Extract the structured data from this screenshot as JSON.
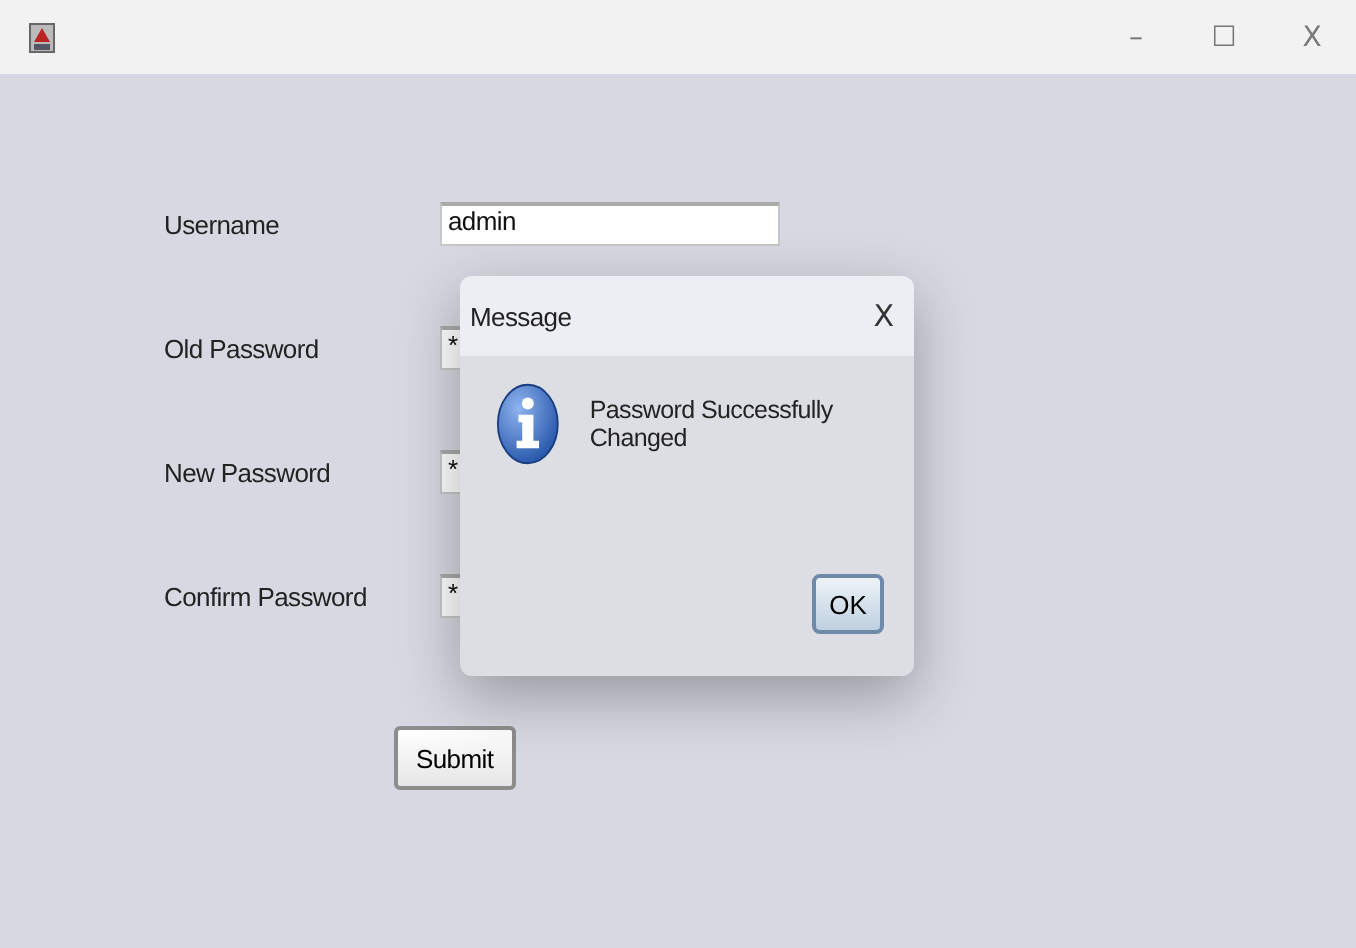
{
  "window": {
    "controls": [
      "–",
      "☐",
      "X"
    ]
  },
  "form": {
    "fields": [
      {
        "label": "Username",
        "value": "admin"
      },
      {
        "label": "Old Password",
        "value": "*"
      },
      {
        "label": "New Password",
        "value": "*"
      },
      {
        "label": "Confirm Password",
        "value": "*"
      }
    ],
    "submit": "Submit"
  },
  "dialog": {
    "title": "Message",
    "close": "X",
    "message": "Password Successfully Changed",
    "button": "OK"
  }
}
